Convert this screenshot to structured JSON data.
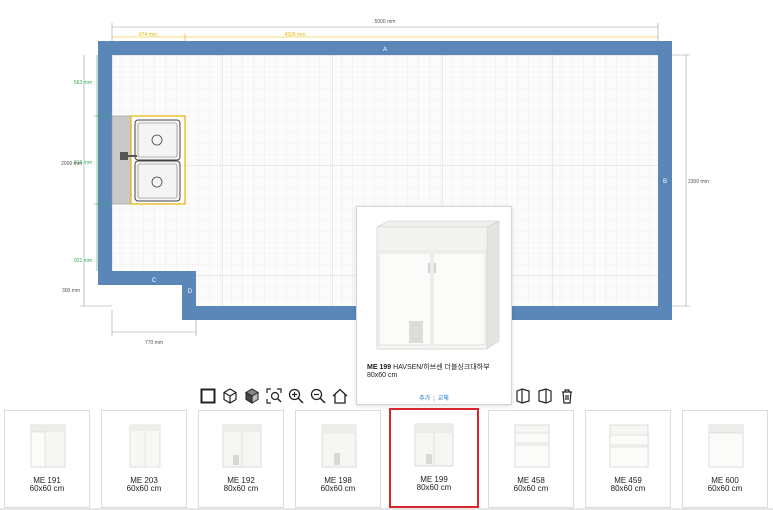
{
  "colors": {
    "wall": "#5b86b8",
    "accent": "#e8b200",
    "green_dim": "#2eaa55",
    "selected": "#d9262c",
    "link": "#0a6fc2"
  },
  "plan": {
    "dim_top_total": "5000 mm",
    "dim_top_left": "674 mm",
    "dim_top_right": "4326 mm",
    "dim_left_top": "563 mm",
    "dim_left_mid": "816 mm",
    "dim_left_bottom": "921 mm",
    "dim_left_total": "2000 mm",
    "dim_left_notch": "300 mm",
    "dim_bottom_notch": "770 mm",
    "dim_right_total": "2300 mm",
    "wall_a": "A",
    "wall_b": "B",
    "wall_c": "C",
    "wall_d": "D"
  },
  "toolbar": {
    "tools": [
      "select-tool-icon",
      "3d-view-icon",
      "3d-solid-icon",
      "zoom-fit-icon",
      "zoom-in-icon",
      "zoom-out-icon",
      "home-icon",
      "wall-left-icon",
      "wall-right-icon",
      "delete-icon"
    ]
  },
  "popup": {
    "code": "ME 199",
    "desc": "HAVSEN/하브센 더블싱크대하부",
    "size": "80x60 cm",
    "add_label": "추가",
    "replace_label": "교체"
  },
  "tray": {
    "items": [
      {
        "code": "ME 191",
        "size": "60x60 cm"
      },
      {
        "code": "ME 203",
        "size": "60x60 cm"
      },
      {
        "code": "ME 192",
        "size": "80x60 cm"
      },
      {
        "code": "ME 198",
        "size": "60x60 cm"
      },
      {
        "code": "ME 199",
        "size": "80x60 cm"
      },
      {
        "code": "ME 458",
        "size": "60x60 cm"
      },
      {
        "code": "ME 459",
        "size": "80x60 cm"
      },
      {
        "code": "ME 600",
        "size": "60x60 cm"
      }
    ],
    "selected_index": 4
  }
}
